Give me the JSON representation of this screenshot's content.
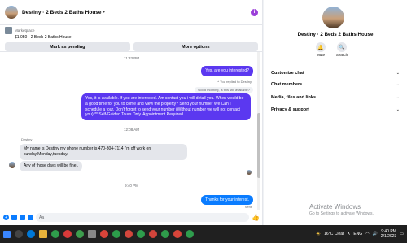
{
  "header": {
    "title": "Destiny · 2 Beds 2 Baths House"
  },
  "marketplace": {
    "label": "Marketplace",
    "price_title": "$1,050 · 2 Beds 2 Baths House",
    "mark_pending": "Mark as pending",
    "more_options": "More options"
  },
  "messages": {
    "ts1": "11:33 PM",
    "out1": "Yes, are you interested?",
    "replied_note": "You replied to Destiny",
    "quoted": "Good morning, is this still available?",
    "out2": "Yes, it is available. If you are interested.  Am contact you i will detail you.  When would be a good time for you to come and view the property? Send your number We Can I schedule a tour.  Don't forget to send your number (Without number we will not contact you).** Self-Guided Tours Only. Appointment Required.",
    "ts2": "12:08 AM",
    "sender": "Destiny",
    "in1": "My name is Destiny my phone number is 470-304-7114 I'm off work on sunday,Monday,tuesday.",
    "in2": "Any of those days will be fine..",
    "ts3": "9:40 PM",
    "out3": "Thanks for your interest.",
    "sent": "Sent"
  },
  "composer": {
    "placeholder": "Aa"
  },
  "right_panel": {
    "name": "Destiny · 2 Beds 2 Baths House",
    "mute": "Mute",
    "search": "Search",
    "sections": [
      "Customize chat",
      "Chat members",
      "Media, files and links",
      "Privacy & support"
    ]
  },
  "watermark": {
    "line1": "Activate Windows",
    "line2": "Go to Settings to activate Windows."
  },
  "taskbar": {
    "weather": "16°C  Clear",
    "lang": "ENG",
    "time": "9:40 PM",
    "date": "2/1/2023"
  },
  "colors": {
    "accent": "#5b38f0",
    "blue": "#0a7cff",
    "taskbar": "#202020"
  }
}
